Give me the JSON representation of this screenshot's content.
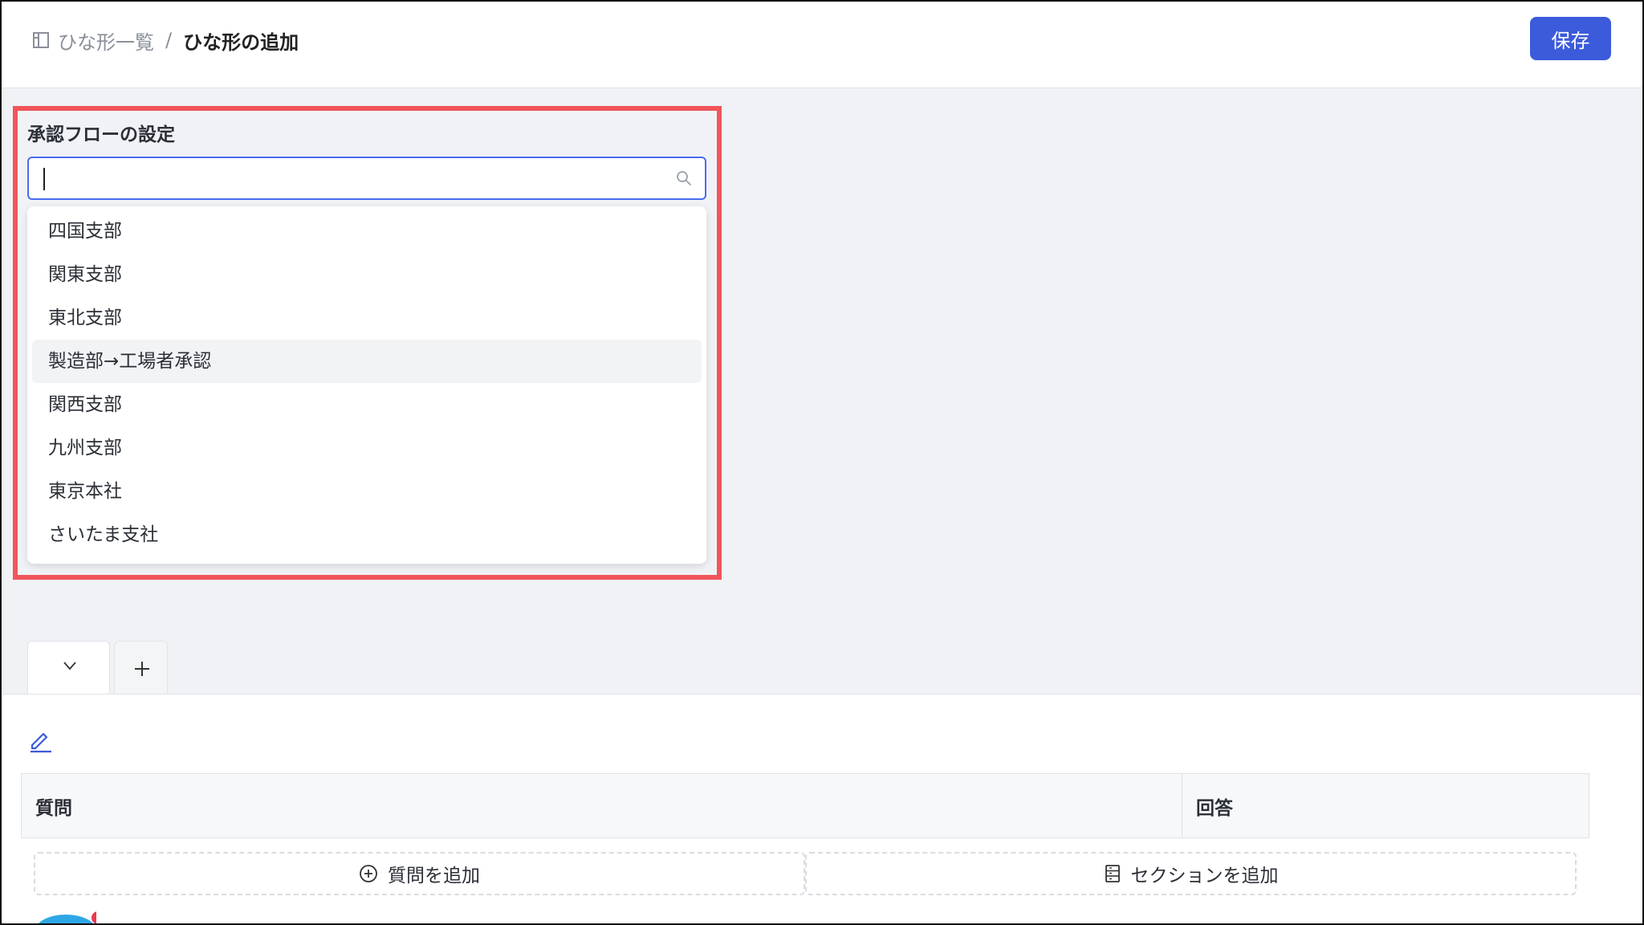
{
  "header": {
    "breadcrumb_parent": "ひな形一覧",
    "breadcrumb_separator": "/",
    "breadcrumb_current": "ひな形の追加",
    "save_label": "保存"
  },
  "approval_flow": {
    "title": "承認フローの設定",
    "search_value": "",
    "options": [
      "四国支部",
      "関東支部",
      "東北支部",
      "製造部→工場者承認",
      "関西支部",
      "九州支部",
      "東京本社",
      "さいたま支社"
    ],
    "hovered_index": 3
  },
  "table": {
    "col_question": "質問",
    "col_answer": "回答"
  },
  "actions": {
    "add_question": "質問を追加",
    "add_section": "セクションを追加"
  },
  "colors": {
    "primary": "#3b5bdb",
    "highlight": "#f0555a"
  }
}
